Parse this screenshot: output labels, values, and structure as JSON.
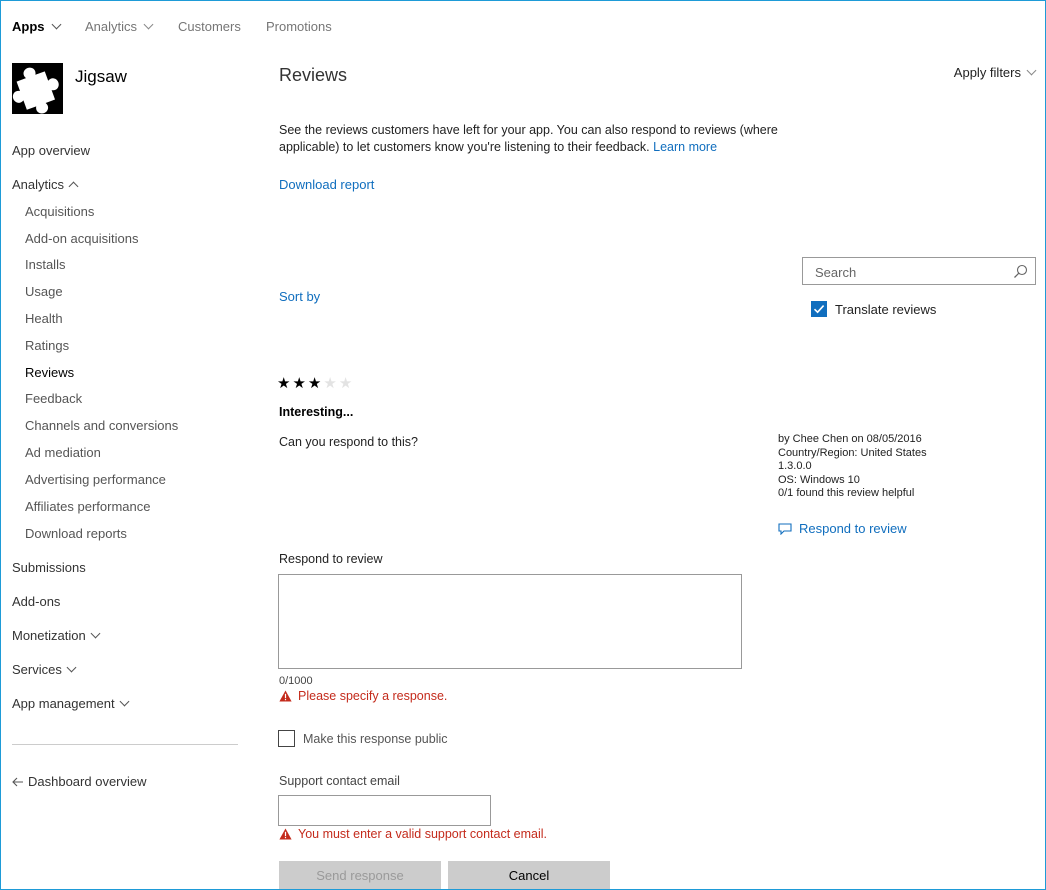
{
  "topnav": {
    "apps": "Apps",
    "analytics": "Analytics",
    "customers": "Customers",
    "promotions": "Promotions"
  },
  "app": {
    "name": "Jigsaw"
  },
  "sidebar": {
    "app_overview": "App overview",
    "analytics": "Analytics",
    "analytics_items": [
      "Acquisitions",
      "Add-on acquisitions",
      "Installs",
      "Usage",
      "Health",
      "Ratings",
      "Reviews",
      "Feedback",
      "Channels and conversions",
      "Ad mediation",
      "Advertising performance",
      "Affiliates performance",
      "Download reports"
    ],
    "submissions": "Submissions",
    "addons": "Add-ons",
    "monetization": "Monetization",
    "services": "Services",
    "app_management": "App management",
    "dashboard_overview": "Dashboard overview"
  },
  "main": {
    "title": "Reviews",
    "apply_filters": "Apply filters",
    "description": "See the reviews customers have left for your app. You can also respond to reviews (where applicable) to let customers know you're listening to their feedback.",
    "learn_more": "Learn more",
    "download_report": "Download report",
    "sort_by": "Sort by",
    "search_placeholder": "Search",
    "translate_reviews": "Translate reviews"
  },
  "review": {
    "rating": 3,
    "max_rating": 5,
    "title": "Interesting...",
    "text": "Can you respond to this?",
    "meta": [
      "by Chee Chen on 08/05/2016",
      "Country/Region: United States",
      "1.3.0.0",
      "OS: Windows 10",
      "0/1 found this review helpful"
    ],
    "respond_link": "Respond to review"
  },
  "response": {
    "label": "Respond to review",
    "value": "",
    "counter": "0/1000",
    "error": "Please specify a response.",
    "public_label": "Make this response public",
    "email_label": "Support contact email",
    "email_value": "",
    "email_error": "You must enter a valid support contact email.",
    "send": "Send response",
    "cancel": "Cancel"
  },
  "colors": {
    "accent": "#106ebe",
    "error": "#c42b1c",
    "frame": "#1e9bd7"
  }
}
